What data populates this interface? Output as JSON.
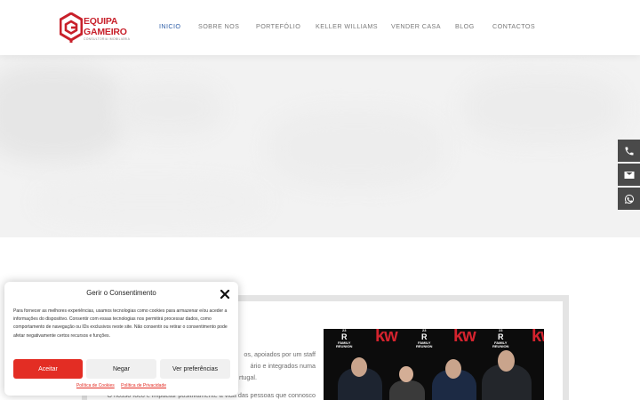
{
  "brand": {
    "line1": "EQUIPA",
    "line2": "GAMEIRO",
    "tagline": "CONSULTORIA IMOBILIÁRIA",
    "accent_color": "#c8202a"
  },
  "nav": {
    "items": [
      {
        "label": "INICIO",
        "active": true
      },
      {
        "label": "SOBRE NOS",
        "active": false
      },
      {
        "label": "PORTEFÓLIO",
        "active": false
      },
      {
        "label": "KELLER WILLIAMS",
        "active": false
      },
      {
        "label": "VENDER CASA",
        "active": false
      },
      {
        "label": "BLOG",
        "active": false
      },
      {
        "label": "CONTACTOS",
        "active": false
      }
    ],
    "active_color": "#2f5fa8"
  },
  "floating_contacts": [
    {
      "icon": "phone-icon"
    },
    {
      "icon": "envelope-icon"
    },
    {
      "icon": "whatsapp-icon"
    }
  ],
  "content": {
    "line1": "os, apoiados por um staff",
    "line2": "ário e integrados numa",
    "line3": "rtugal.",
    "line4": "O nosso foco é impactar positivamente a vida das pessoas que connosco",
    "photo": {
      "kw": "kw",
      "badge_top": "23",
      "badge_mid": "FAMILY",
      "badge_bottom": "REUNION"
    }
  },
  "cookie": {
    "title": "Gerir o Consentimento",
    "body": "Para fornecer as melhores experiências, usamos tecnologias como cookies para armazenar e/ou aceder a informações do dispositivo. Consentir com essas tecnologias nos permitirá processar dados, como comportamento de navegação ou IDs exclusivos neste site. Não consentir ou retirar o consentimento pode afetar negativamente certos recursos e funções.",
    "accept_label": "Aceitar",
    "deny_label": "Negar",
    "prefs_label": "Ver preferências",
    "cookie_policy_label": "Política de Cookies",
    "privacy_policy_label": "Política de Privacidade",
    "accent_color": "#e32d24"
  }
}
